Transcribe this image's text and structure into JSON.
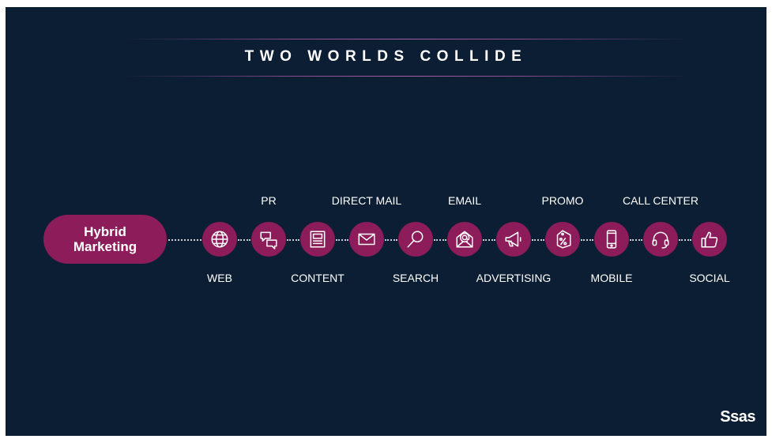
{
  "slide": {
    "title": "TWO WORLDS COLLIDE",
    "hub_label_line1": "Hybrid",
    "hub_label_line2": "Marketing",
    "brand": "Ssas"
  },
  "colors": {
    "background": "#0c1e33",
    "accent": "#8c1c5a",
    "text": "#ffffff"
  },
  "channels": [
    {
      "label": "WEB",
      "icon": "globe-icon",
      "label_position": "bottom"
    },
    {
      "label": "PR",
      "icon": "chat-bubbles-icon",
      "label_position": "top"
    },
    {
      "label": "CONTENT",
      "icon": "newspaper-icon",
      "label_position": "bottom"
    },
    {
      "label": "DIRECT MAIL",
      "icon": "envelope-icon",
      "label_position": "top"
    },
    {
      "label": "SEARCH",
      "icon": "magnifier-icon",
      "label_position": "bottom"
    },
    {
      "label": "EMAIL",
      "icon": "email-at-icon",
      "label_position": "top"
    },
    {
      "label": "ADVERTISING",
      "icon": "megaphone-icon",
      "label_position": "bottom"
    },
    {
      "label": "PROMO",
      "icon": "tag-percent-icon",
      "label_position": "top"
    },
    {
      "label": "MOBILE",
      "icon": "smartphone-icon",
      "label_position": "bottom"
    },
    {
      "label": "CALL CENTER",
      "icon": "headset-icon",
      "label_position": "top"
    },
    {
      "label": "SOCIAL",
      "icon": "thumbs-up-icon",
      "label_position": "bottom"
    }
  ]
}
